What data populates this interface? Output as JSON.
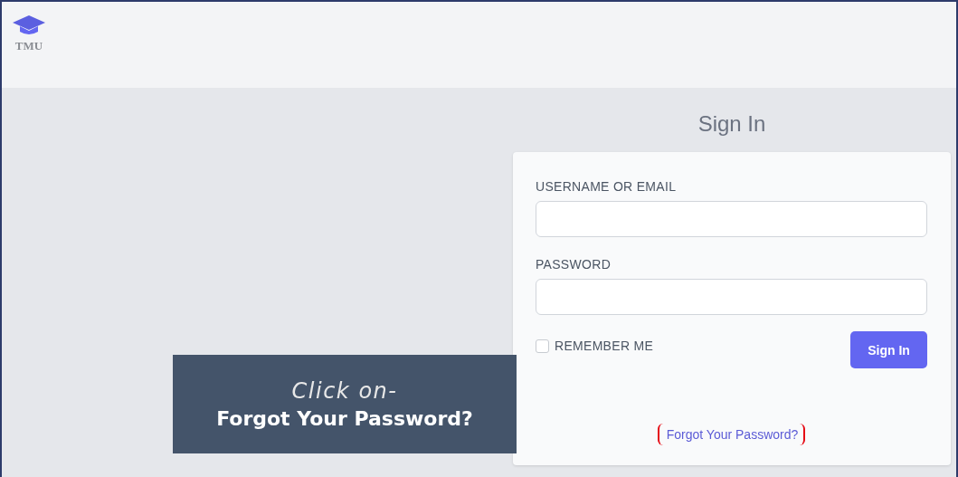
{
  "header": {
    "logo_text": "TMU"
  },
  "form": {
    "title": "Sign In",
    "fields": [
      {
        "label": "USERNAME OR EMAIL"
      },
      {
        "label": "PASSWORD"
      }
    ],
    "remember": {
      "label": "REMEMBER ME",
      "checked": false
    },
    "submit": "Sign In",
    "forgot_link": {
      "label": "Forgot Your Password?",
      "highlighted": true
    }
  },
  "callout": {
    "lines": [
      {
        "text": "Click on-",
        "kind": "italic"
      },
      {
        "text": "Forgot Your Password?",
        "kind": "bold"
      }
    ]
  }
}
